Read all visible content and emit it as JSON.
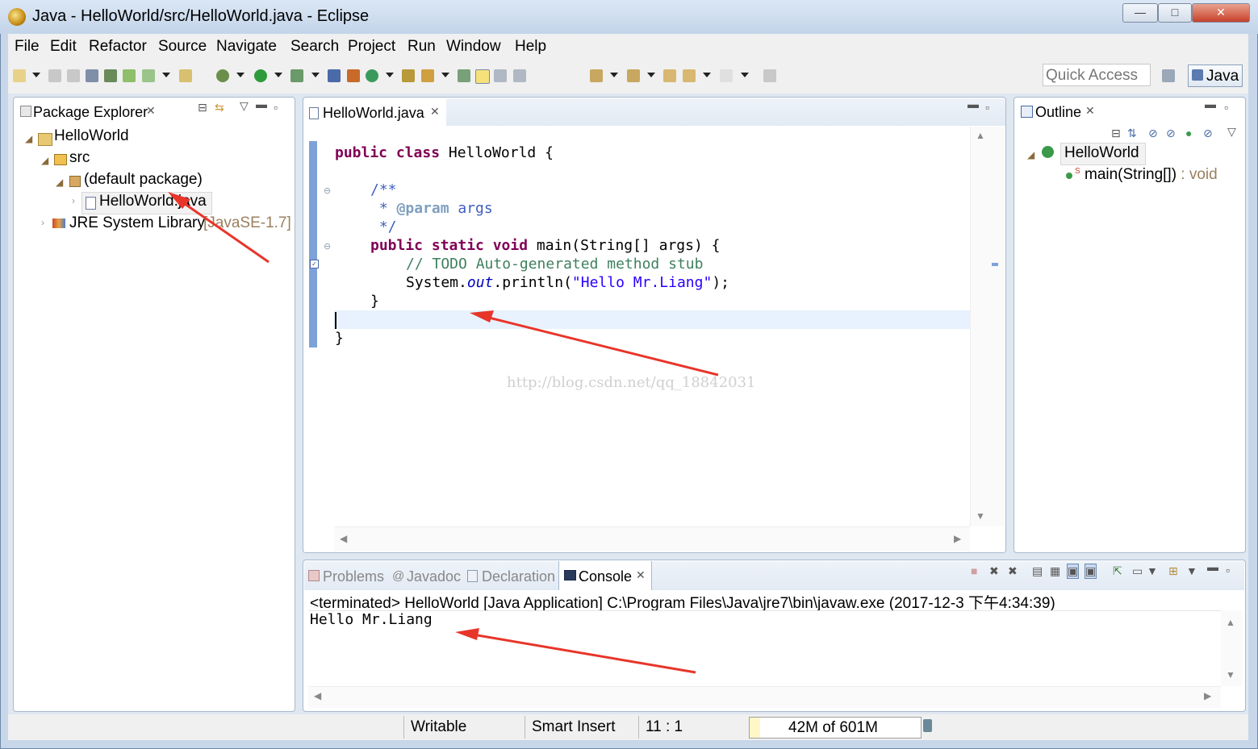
{
  "window": {
    "title": "Java - HelloWorld/src/HelloWorld.java - Eclipse",
    "minimize_symbol": "—",
    "maximize_symbol": "□",
    "close_symbol": "✕"
  },
  "menu": [
    "File",
    "Edit",
    "Refactor",
    "Source",
    "Navigate",
    "Search",
    "Project",
    "Run",
    "Window",
    "Help"
  ],
  "toolbar": {
    "quick_access_placeholder": "Quick Access",
    "perspective_label": "Java"
  },
  "package_explorer": {
    "tab_label": "Package Explorer",
    "project": "HelloWorld",
    "src": "src",
    "package": "(default package)",
    "file": "HelloWorld.java",
    "library": "JRE System Library",
    "library_version": "[JavaSE-1.7]"
  },
  "editor": {
    "tab_label": "HelloWorld.java",
    "lines": {
      "class_decl_kw": "public class",
      "class_decl_rest": " HelloWorld {",
      "javadoc_open": "/**",
      "javadoc_param_star": " * ",
      "javadoc_param_tag": "@param",
      "javadoc_param_name": " args",
      "javadoc_close": " */",
      "method_kw": "public static void",
      "method_rest": " main(String[] args) {",
      "todo_comment": "// TODO Auto-generated method stub",
      "println_prefix": "System.",
      "println_field": "out",
      "println_mid": ".println(",
      "println_string": "\"Hello Mr.Liang\"",
      "println_end": ");",
      "method_close": "}",
      "class_close": "}"
    }
  },
  "outline": {
    "tab_label": "Outline",
    "class_name": "HelloWorld",
    "method_name": "main(String[])",
    "method_type": " : void"
  },
  "bottom_tabs": {
    "problems": "Problems",
    "javadoc": "Javadoc",
    "declaration": "Declaration",
    "console": "Console"
  },
  "console": {
    "header": "<terminated> HelloWorld [Java Application] C:\\Program Files\\Java\\jre7\\bin\\javaw.exe (2017-12-3 下午4:34:39)",
    "output": "Hello Mr.Liang"
  },
  "status": {
    "writable": "Writable",
    "insert_mode": "Smart Insert",
    "position": "11 : 1",
    "memory": "42M of 601M"
  },
  "watermark": "http://blog.csdn.net/qq_18842031",
  "colors": {
    "keyword": "#7f0055",
    "javadoc": "#3f5fbf",
    "comment": "#3f7f5f",
    "string": "#2a00ff",
    "annotation_arrow": "#e8352a"
  }
}
